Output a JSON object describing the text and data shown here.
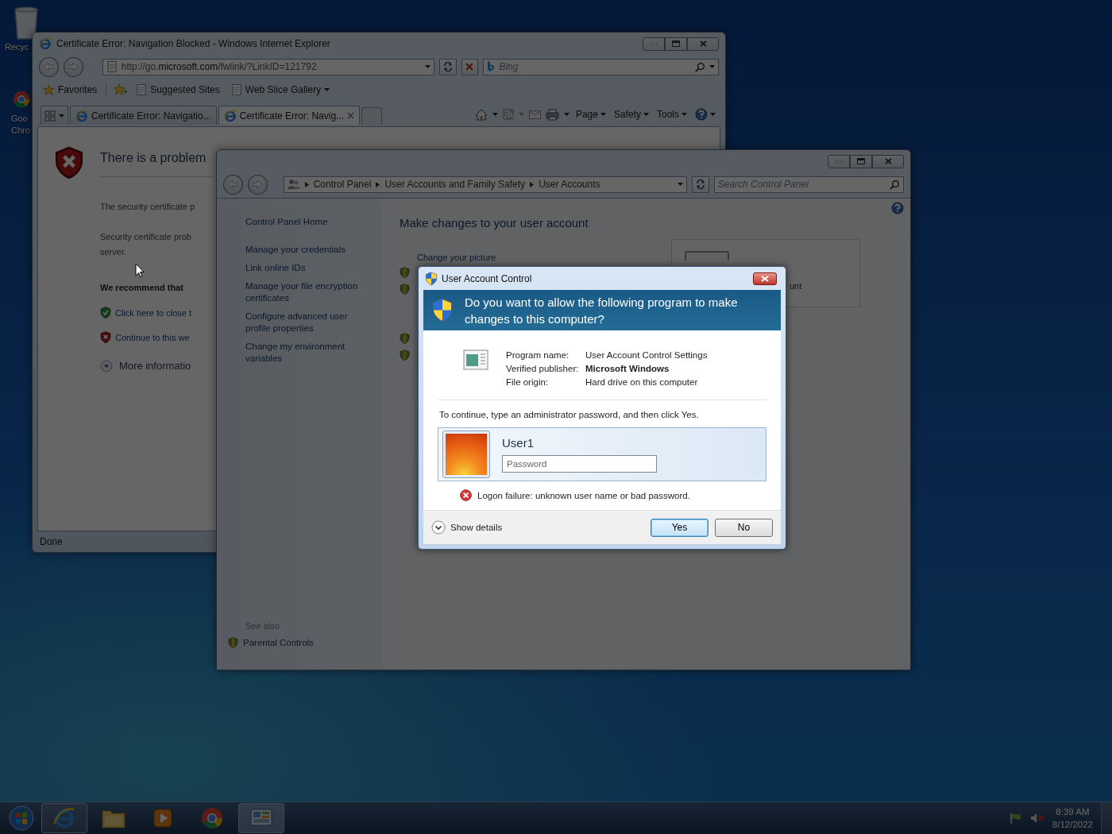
{
  "desktop_icons": [
    {
      "kind": "recycle_bin",
      "lines": [
        "Recyc"
      ]
    },
    {
      "kind": "chrome",
      "lines": [
        "Goo",
        "Chro"
      ]
    }
  ],
  "ie_window": {
    "title": "Certificate Error: Navigation Blocked - Windows Internet Explorer",
    "address": "http://go.microsoft.com/fwlink/?LinkID=121792",
    "search_placeholder": "Bing",
    "favorites_bar": {
      "favorites": "Favorites",
      "links": [
        "Suggested Sites",
        "Web Slice Gallery"
      ]
    },
    "tabs": [
      {
        "label": "Certificate Error: Navigatio...",
        "selected": false
      },
      {
        "label": "Certificate Error: Navig...",
        "selected": true
      }
    ],
    "commands": [
      "Page",
      "Safety",
      "Tools"
    ],
    "content": {
      "heading": "There is a problem",
      "paragraphs": [
        [
          "The security certificate p"
        ],
        [
          "Security certificate prob",
          "server."
        ]
      ],
      "recommendation": "We recommend that",
      "options": [
        {
          "kind": "safe",
          "label": "Click here to close t"
        },
        {
          "kind": "unsafe",
          "label": "Continue to this we"
        }
      ],
      "more": "More informatio"
    },
    "status": "Done"
  },
  "control_panel": {
    "breadcrumb": [
      "Control Panel",
      "User Accounts and Family Safety",
      "User Accounts"
    ],
    "search_placeholder": "Search Control Panel",
    "sidebar": {
      "items": [
        "Control Panel Home",
        "Manage your credentials",
        "Link online IDs",
        "Manage your file encryption certificates",
        "Configure advanced user profile properties",
        "Change my environment variables"
      ],
      "see_also_title": "See also",
      "see_also": [
        "Parental Controls"
      ]
    },
    "main": {
      "heading": "Make changes to your user account",
      "first_link": "Change your picture",
      "card_text": "unt"
    }
  },
  "uac": {
    "title": "User Account Control",
    "question": "Do you want to allow the following program to make changes to this computer?",
    "details": [
      {
        "label": "Program name:",
        "value": "User Account Control Settings",
        "bold": false
      },
      {
        "label": "Verified publisher:",
        "value": "Microsoft Windows",
        "bold": true
      },
      {
        "label": "File origin:",
        "value": "Hard drive on this computer",
        "bold": false
      }
    ],
    "instruction": "To continue, type an administrator password, and then click Yes.",
    "user_name": "User1",
    "password_placeholder": "Password",
    "error": "Logon failure: unknown user name or bad password.",
    "show_details": "Show details",
    "buttons": [
      {
        "label": "Yes",
        "default": true
      },
      {
        "label": "No",
        "default": false
      }
    ]
  },
  "taskbar": {
    "items": [
      {
        "kind": "ie",
        "running": true,
        "selected": false
      },
      {
        "kind": "explorer",
        "running": false,
        "selected": false
      },
      {
        "kind": "media",
        "running": false,
        "selected": false
      },
      {
        "kind": "chrome",
        "running": false,
        "selected": false
      },
      {
        "kind": "control_panel",
        "running": true,
        "selected": true
      }
    ],
    "volume_muted": true,
    "time": "8:39 AM",
    "date": "8/12/2022"
  }
}
